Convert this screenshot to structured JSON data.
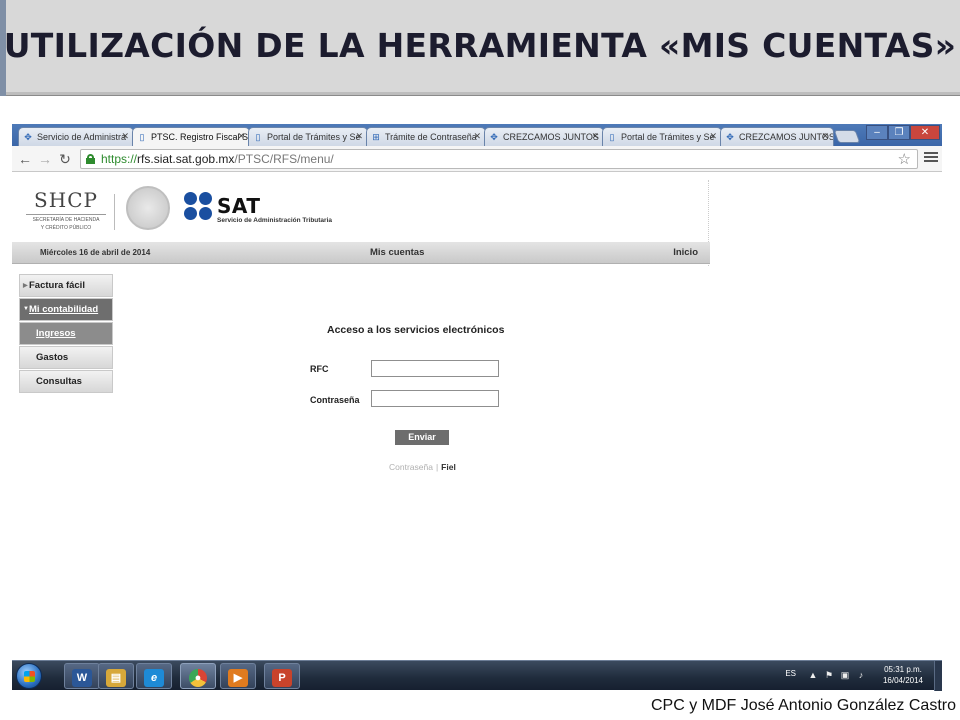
{
  "slide": {
    "title": "UTILIZACIÓN DE LA HERRAMIENTA «MIS CUENTAS»",
    "footer": "CPC y MDF José Antonio González Castro"
  },
  "browser": {
    "tabs": [
      {
        "label": "Servicio de Administra",
        "icon": "sat-favicon",
        "active": false
      },
      {
        "label": "PTSC. Registro Fiscal S",
        "icon": "page-icon",
        "active": true
      },
      {
        "label": "Portal de Trámites y Se",
        "icon": "page-icon",
        "active": false
      },
      {
        "label": "Trámite de Contraseña",
        "icon": "grid-icon",
        "active": false
      },
      {
        "label": "CREZCAMOS JUNTOS",
        "icon": "sat-favicon",
        "active": false
      },
      {
        "label": "Portal de Trámites y Se",
        "icon": "page-icon",
        "active": false
      },
      {
        "label": "CREZCAMOS JUNTOS",
        "icon": "sat-favicon",
        "active": false
      }
    ],
    "url": {
      "scheme": "https://",
      "host": "rfs.siat.sat.gob.mx",
      "path": "/PTSC/RFS/menu/"
    }
  },
  "site": {
    "shcp": {
      "name": "SHCP",
      "subtitle_1": "SECRETARÍA DE HACIENDA",
      "subtitle_2": "Y CRÉDITO PÚBLICO"
    },
    "sat": {
      "name": "SAT",
      "subtitle": "Servicio de Administración Tributaria",
      "brand_color": "#1a4fa0"
    },
    "navbar": {
      "date": "Miércoles 16 de abril de 2014",
      "section": "Mis cuentas",
      "home": "Inicio"
    },
    "sidemenu": [
      {
        "label": "Factura fácil",
        "kind": "parent"
      },
      {
        "label": "Mi contabilidad",
        "kind": "parent-active"
      },
      {
        "label": "Ingresos",
        "kind": "sub-active"
      },
      {
        "label": "Gastos",
        "kind": "sub"
      },
      {
        "label": "Consultas",
        "kind": "sub"
      }
    ],
    "login": {
      "title": "Acceso a los servicios electrónicos",
      "rfc_label": "RFC",
      "rfc_value": "",
      "password_label": "Contraseña",
      "password_value": "",
      "submit": "Enviar",
      "link_password": "Contraseña",
      "link_separator": "|",
      "link_fiel": "Fiel"
    }
  },
  "taskbar": {
    "apps": [
      {
        "name": "word",
        "glyph": "W",
        "color": "#2b5797"
      },
      {
        "name": "explorer",
        "glyph": "▤",
        "color": "#e0b040"
      },
      {
        "name": "internet-explorer",
        "glyph": "e",
        "color": "#1e8ad6"
      },
      {
        "name": "chrome",
        "glyph": "◉",
        "color": "#d94535"
      },
      {
        "name": "media",
        "glyph": "▶",
        "color": "#e07b1f"
      },
      {
        "name": "powerpoint",
        "glyph": "P",
        "color": "#c8432b"
      }
    ],
    "tray": {
      "lang": "ES",
      "time": "05:31 p.m.",
      "date": "16/04/2014"
    }
  }
}
